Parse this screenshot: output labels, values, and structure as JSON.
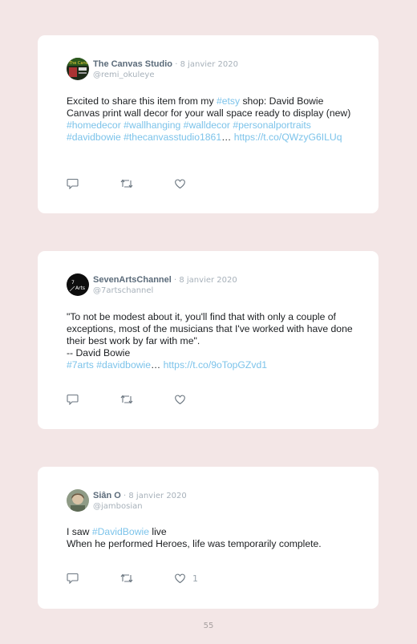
{
  "tweets": [
    {
      "author_name": "The Canvas Studio",
      "separator": " · ",
      "date": "8 janvier 2020",
      "handle": "@remi_okuleye",
      "text_parts": {
        "t1": "Excited to share this item from my ",
        "l1": "#etsy",
        "t2": " shop: David Bowie Canvas print wall decor for your wall space ready to display (new) ",
        "l2": "#homedecor #wallhanging #walldecor #personalportraits #davidbowie #thecanvasstudio1861",
        "t3": "… ",
        "l3": "https://t.co/QWzyG6ILUq"
      },
      "likes": ""
    },
    {
      "author_name": "SevenArtsChannel",
      "separator": " · ",
      "date": "8 janvier 2020",
      "handle": "@7artschannel",
      "text_parts": {
        "line1": "\"To not be modest about it, you'll find that with only a couple of exceptions, most of the musicians that I've worked with have done their best work by far with me\".",
        "line2": "-- David Bowie",
        "l1": "#7arts #davidbowie",
        "t1": "… ",
        "l2": "https://t.co/9oTopGZvd1"
      },
      "likes": ""
    },
    {
      "author_name": "Siân O",
      "separator": " · ",
      "date": "8 janvier 2020",
      "handle": "@jambosian",
      "text_parts": {
        "t1": "I saw ",
        "l1": "#DavidBowie",
        "t2": " live",
        "line2": "When he performed Heroes, life was temporarily complete."
      },
      "likes": "1"
    }
  ],
  "page_number": "55",
  "colors": {
    "background": "#f3e6e6",
    "card": "#ffffff",
    "link": "#7cc3ea",
    "muted": "#a7b1ba",
    "name": "#5b6b7a"
  },
  "icons": [
    "reply-icon",
    "retweet-icon",
    "like-icon"
  ]
}
